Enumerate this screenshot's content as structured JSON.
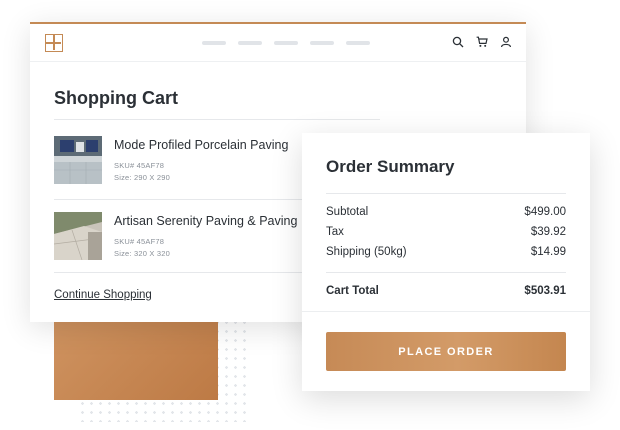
{
  "header": {
    "logo": "logo-grid-icon",
    "nav_items": [
      "",
      "",
      "",
      "",
      ""
    ],
    "icons": [
      "search-icon",
      "cart-icon",
      "user-icon"
    ]
  },
  "cart": {
    "title": "Shopping Cart",
    "items": [
      {
        "name": "Mode Profiled Porcelain Paving",
        "sku": "SKU# 45AF78",
        "size": "Size: 290 X 290",
        "thumb": "pool-paving-photo"
      },
      {
        "name": "Artisan Serenity Paving & Paving",
        "sku": "SKU# 45AF78",
        "size": "Size: 320 X 320",
        "thumb": "stone-paving-photo"
      }
    ],
    "continue_label": "Continue Shopping"
  },
  "summary": {
    "title": "Order Summary",
    "rows": [
      {
        "label": "Subtotal",
        "value": "$499.00"
      },
      {
        "label": "Tax",
        "value": "$39.92"
      },
      {
        "label": "Shipping (50kg)",
        "value": "$14.99"
      }
    ],
    "total": {
      "label": "Cart Total",
      "value": "$503.91"
    },
    "button_label": "PLACE ORDER"
  },
  "colors": {
    "accent": "#c48a55",
    "text": "#2b3036",
    "muted": "#8a9098"
  }
}
